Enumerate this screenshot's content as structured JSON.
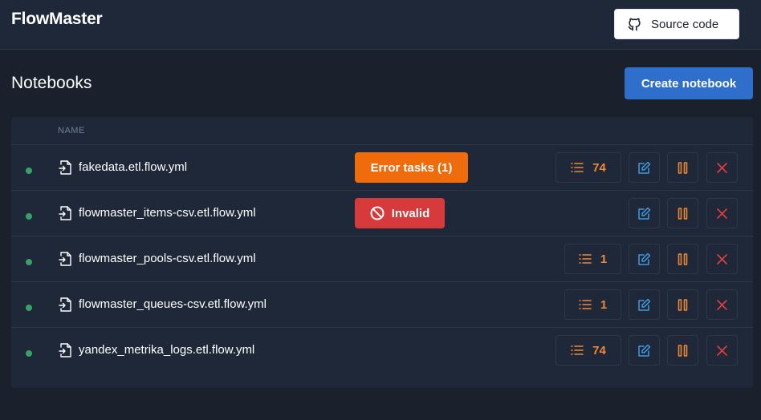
{
  "header": {
    "brand": "FlowMaster",
    "source_button_label": "Source code"
  },
  "page": {
    "title": "Notebooks",
    "create_button_label": "Create notebook"
  },
  "table": {
    "column_name": "NAME",
    "rows": [
      {
        "name": "fakedata.etl.flow.yml",
        "status_color": "#38a169",
        "badge": "Error tasks (1)",
        "badge_type": "error",
        "tasks": "74"
      },
      {
        "name": "flowmaster_items-csv.etl.flow.yml",
        "status_color": "#38a169",
        "badge": "Invalid",
        "badge_type": "invalid",
        "tasks": null
      },
      {
        "name": "flowmaster_pools-csv.etl.flow.yml",
        "status_color": "#38a169",
        "badge": null,
        "tasks": "1"
      },
      {
        "name": "flowmaster_queues-csv.etl.flow.yml",
        "status_color": "#38a169",
        "badge": null,
        "tasks": "1"
      },
      {
        "name": "yandex_metrika_logs.etl.flow.yml",
        "status_color": "#38a169",
        "badge": null,
        "tasks": "74"
      }
    ]
  },
  "colors": {
    "accent_blue": "#2f6fcb",
    "error_orange": "#ee6c0c",
    "invalid_red": "#d63a3a",
    "tasks_orange": "#ed8936",
    "edit_blue": "#4299e1",
    "delete_red": "#e53e3e",
    "status_green": "#38a169"
  },
  "icons": {
    "source": "github-icon",
    "file": "file-import-icon",
    "tasks": "list-icon",
    "edit": "edit-icon",
    "pause": "pause-icon",
    "delete": "close-icon",
    "invalid": "ban-icon"
  }
}
